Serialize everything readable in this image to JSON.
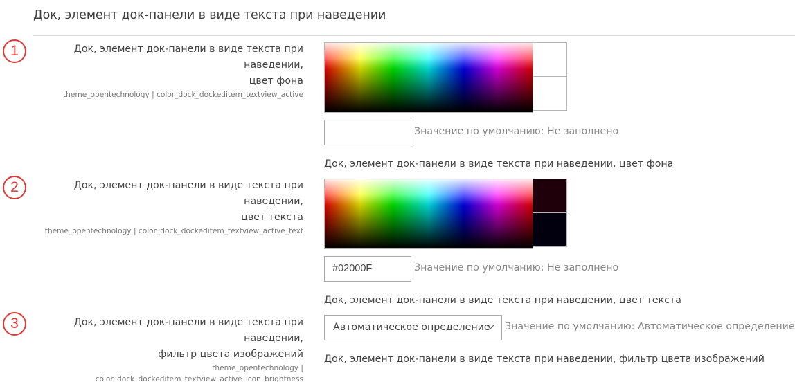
{
  "section": {
    "title": "Док, элемент док-панели в виде текста при наведении"
  },
  "settings": [
    {
      "number": "1",
      "label_line1": "Док, элемент док-панели в виде текста при наведении,",
      "label_line2": "цвет фона",
      "key": "theme_opentechnology | color_dock_dockeditem_textview_active",
      "current_color": "#ffffff",
      "previous_color": "#ffffff",
      "input_value": "",
      "default_note": "Значение по умолчанию: Не заполнено",
      "description": "Док, элемент док-панели в виде текста при наведении, цвет фона"
    },
    {
      "number": "2",
      "label_line1": "Док, элемент док-панели в виде текста при наведении,",
      "label_line2": "цвет текста",
      "key": "theme_opentechnology | color_dock_dockeditem_textview_active_text",
      "current_color": "#1f000a",
      "previous_color": "#02000F",
      "input_value": "#02000F",
      "default_note": "Значение по умолчанию: Не заполнено",
      "description": "Док, элемент док-панели в виде текста при наведении, цвет текста"
    },
    {
      "number": "3",
      "label_line1": "Док, элемент док-панели в виде текста при наведении,",
      "label_line2": "фильтр цвета изображений",
      "key_line1": "theme_opentechnology |",
      "key_line2": "color_dock_dockeditem_textview_active_icon_brightness",
      "select_value": "Автоматическое определение",
      "default_note": "Значение по умолчанию: Автоматическое определение",
      "description": "Док, элемент док-панели в виде текста при наведении, фильтр цвета изображений"
    }
  ],
  "colors": {
    "badge_accent": "#e53935"
  }
}
